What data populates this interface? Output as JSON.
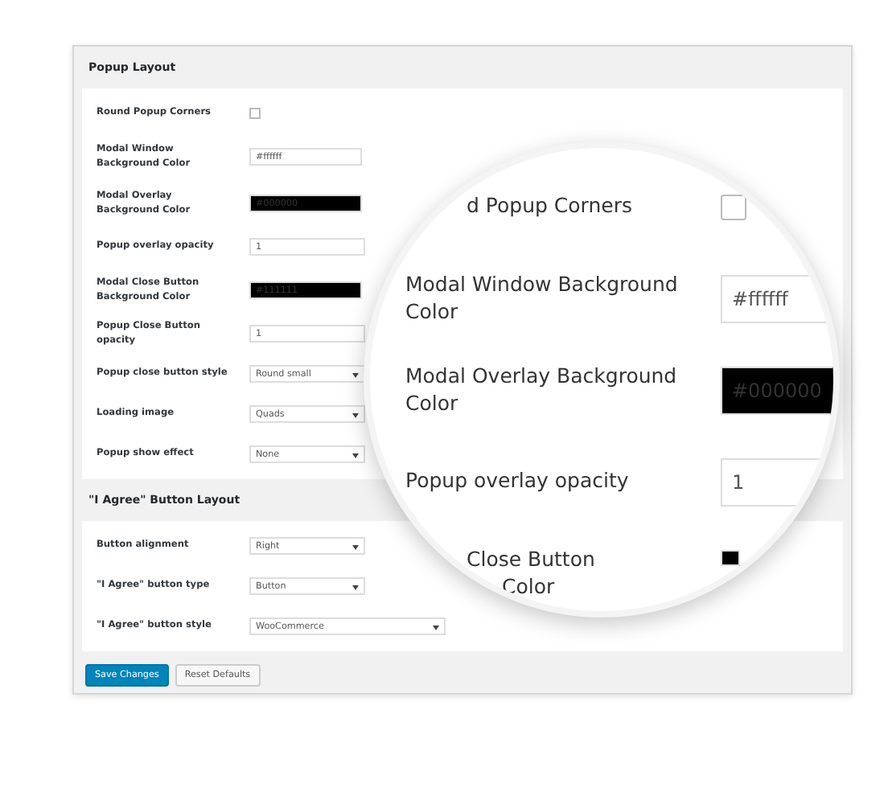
{
  "panel": {
    "sections": [
      {
        "title": "Popup Layout",
        "rows": [
          {
            "label": "Round Popup Corners",
            "kind": "checkbox",
            "checked": false
          },
          {
            "label": "Modal Window Background Color",
            "kind": "color",
            "value": "#ffffff",
            "color": "#ffffff"
          },
          {
            "label": "Modal Overlay Background Color",
            "kind": "color",
            "value": "#000000",
            "color": "#000000"
          },
          {
            "label": "Popup overlay opacity",
            "kind": "text",
            "value": "1"
          },
          {
            "label": "Modal Close Button Background Color",
            "kind": "color",
            "value": "#111111",
            "color": "#000000"
          },
          {
            "label": "Popup Close Button opacity",
            "kind": "text",
            "value": "1"
          },
          {
            "label": "Popup close button style",
            "kind": "select",
            "value": "Round small"
          },
          {
            "label": "Loading image",
            "kind": "select",
            "value": "Quads"
          },
          {
            "label": "Popup show effect",
            "kind": "select",
            "value": "None"
          }
        ]
      },
      {
        "title": "\"I Agree\" Button Layout",
        "rows": [
          {
            "label": "Button alignment",
            "kind": "select",
            "value": "Right"
          },
          {
            "label": "\"I Agree\" button type",
            "kind": "select",
            "value": "Button"
          },
          {
            "label": "\"I Agree\" button style",
            "kind": "select",
            "value": "WooCommerce"
          }
        ]
      }
    ],
    "buttons": [
      {
        "label": "Save Changes",
        "kind": "primary"
      },
      {
        "label": "Reset Defaults",
        "kind": "secondary"
      }
    ]
  },
  "magnifier": {
    "rows": [
      {
        "label": "d Popup Corners",
        "kind": "checkbox",
        "partial": true,
        "checked": false
      },
      {
        "label": "Modal Window Background Color",
        "kind": "color",
        "partial": false,
        "value": "#ffffff",
        "color": "#ffffff"
      },
      {
        "label": "Modal Overlay Background Color",
        "kind": "color",
        "partial": false,
        "value": "#000000",
        "color": "#000000"
      },
      {
        "label": "Popup overlay opacity",
        "kind": "text",
        "partial": false,
        "value": "1"
      },
      {
        "label": "Close Button\nColor",
        "kind": "color",
        "partial": true,
        "color": "#000000"
      }
    ]
  }
}
